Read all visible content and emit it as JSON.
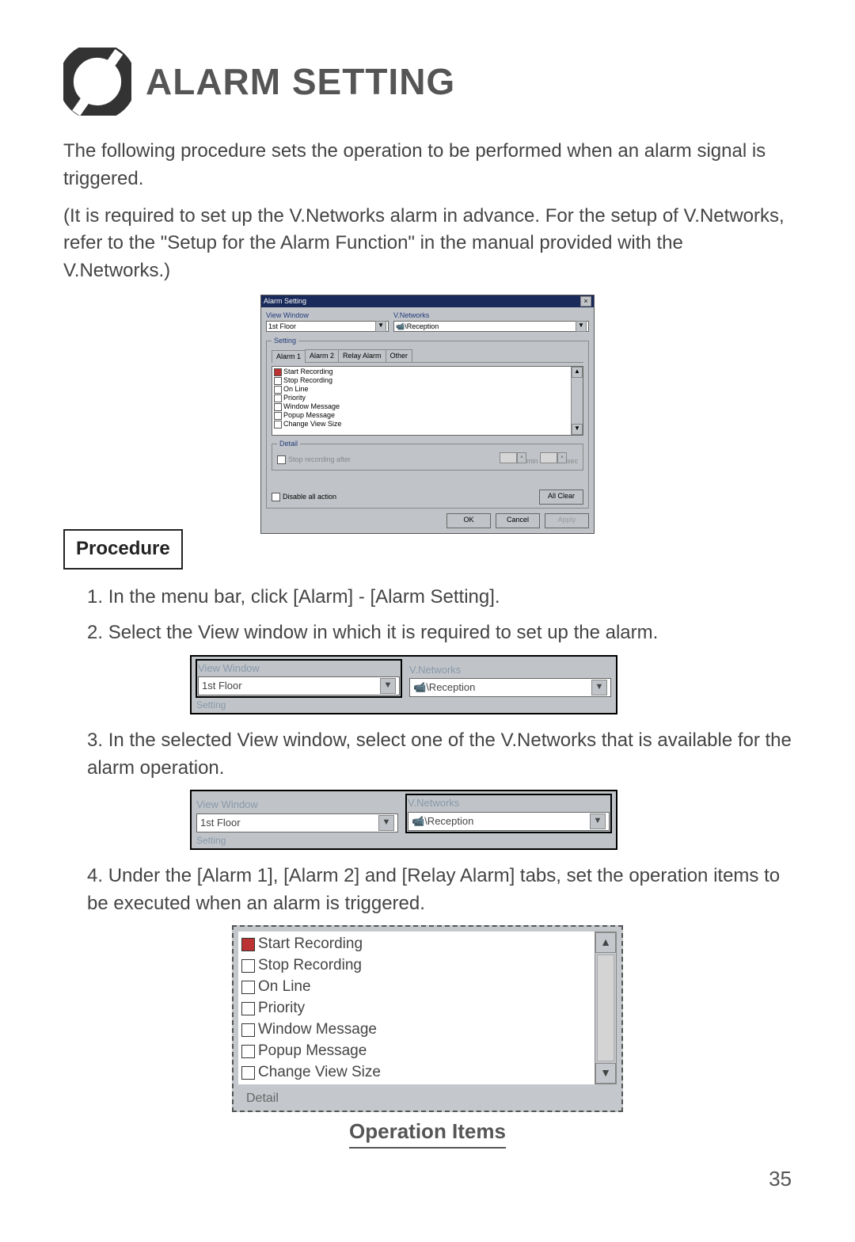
{
  "page": {
    "title": "ALARM SETTING",
    "number": "35"
  },
  "intro": {
    "p1": "The following procedure sets the operation to be performed when an alarm signal is triggered.",
    "p2": "(It is required to set up the V.Networks alarm in advance. For the setup of V.Networks, refer to the \"Setup for the Alarm Function\" in the manual provided with the V.Networks.)"
  },
  "procedure_label": "Procedure",
  "steps": {
    "s1": "In the menu bar, click [Alarm] - [Alarm Setting].",
    "s2": "Select the View window in which it is required to set up the alarm.",
    "s3": "In the selected View window, select one of the V.Networks that is available for the alarm operation.",
    "s4": "Under the [Alarm 1], [Alarm 2] and [Relay Alarm] tabs, set the operation items to be executed when an alarm is triggered."
  },
  "dialog": {
    "title": "Alarm Setting",
    "view_window_label": "View Window",
    "view_window_value": "1st Floor",
    "vnetworks_label": "V.Networks",
    "vnetworks_value": "\\Reception",
    "setting_label": "Setting",
    "tabs": {
      "t1": "Alarm 1",
      "t2": "Alarm 2",
      "t3": "Relay Alarm",
      "t4": "Other"
    },
    "items": {
      "i1": "Start Recording",
      "i2": "Stop Recording",
      "i3": "On Line",
      "i4": "Priority",
      "i5": "Window Message",
      "i6": "Popup Message",
      "i7": "Change View Size"
    },
    "detail_label": "Detail",
    "stop_after_label": "Stop recording after",
    "unit_min": "min",
    "unit_sec": "sec",
    "disable_label": "Disable all action",
    "all_clear": "All Clear",
    "ok": "OK",
    "cancel": "Cancel",
    "apply": "Apply"
  },
  "inset": {
    "view_window_label": "View Window",
    "view_window_value": "1st Floor",
    "vnetworks_label": "V.Networks",
    "vnetworks_value": "\\Reception",
    "setting_cut": "Setting"
  },
  "opitems": {
    "i1": "Start Recording",
    "i2": "Stop Recording",
    "i3": "On Line",
    "i4": "Priority",
    "i5": "Window Message",
    "i6": "Popup Message",
    "i7": "Change View Size",
    "detail": "Detail"
  },
  "caption": "Operation Items"
}
